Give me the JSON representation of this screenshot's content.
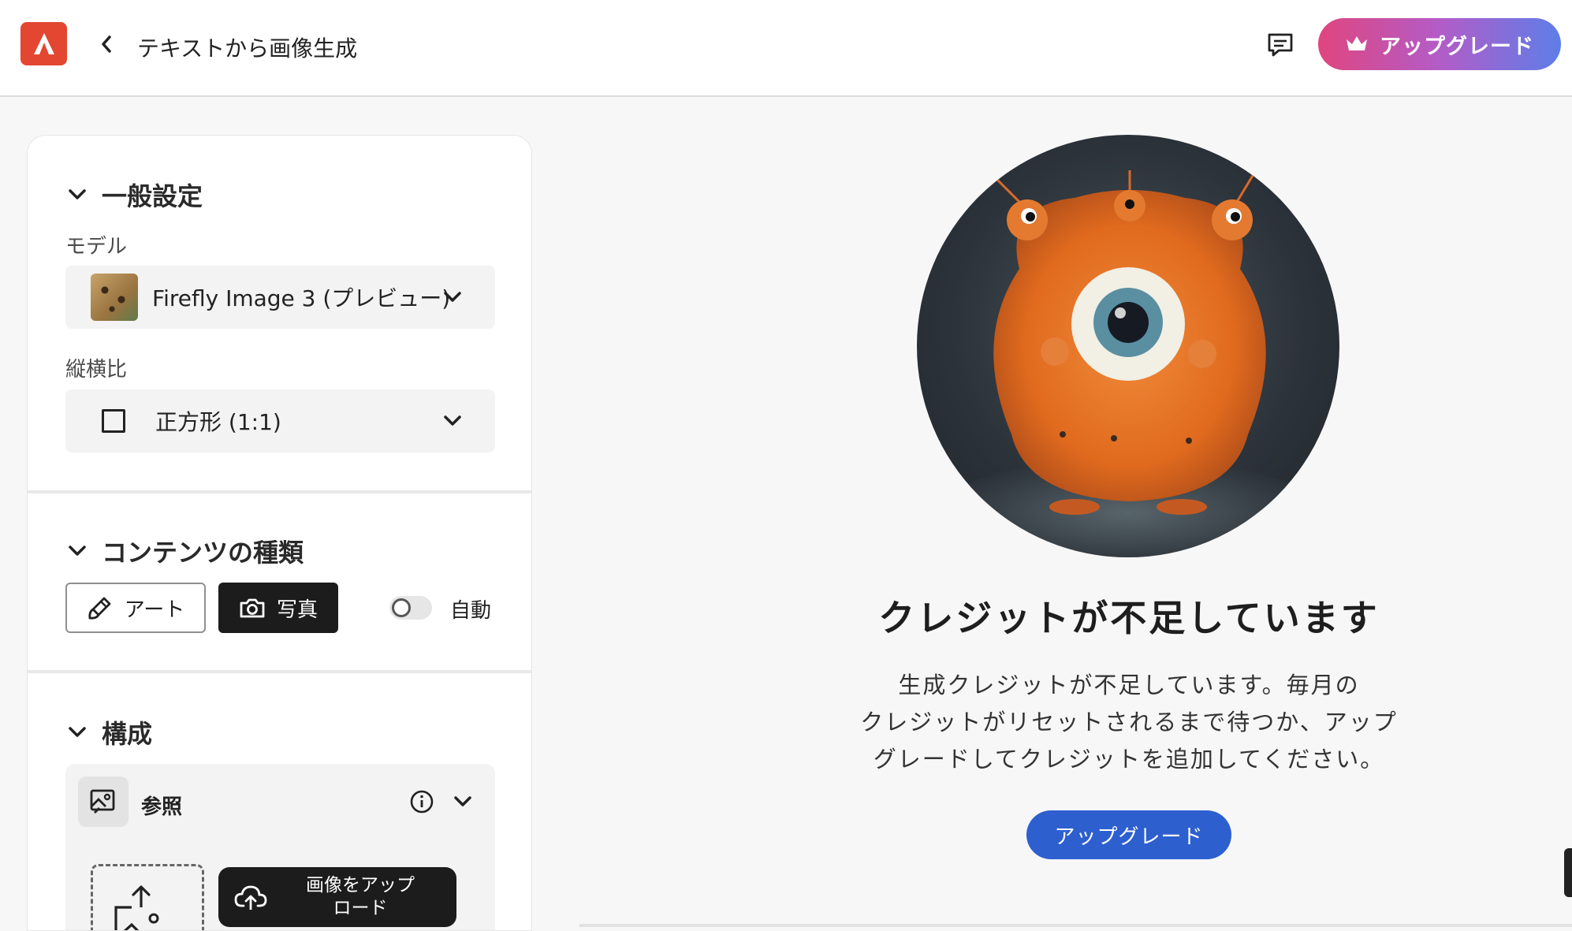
{
  "header": {
    "title": "テキストから画像生成",
    "upgrade_label": "アップグレード"
  },
  "panel": {
    "general": {
      "heading": "一般設定",
      "model_label": "モデル",
      "model_value": "Firefly Image 3 (プレビュー)",
      "aspect_label": "縦横比",
      "aspect_value": "正方形 (1:1)"
    },
    "content_type": {
      "heading": "コンテンツの種類",
      "art_label": "アート",
      "photo_label": "写真",
      "auto_label": "自動",
      "selected": "写真",
      "auto_enabled": false
    },
    "composition": {
      "heading": "構成",
      "reference_label": "参照",
      "upload_label_line1": "画像をアップ",
      "upload_label_line2": "ロード"
    }
  },
  "main": {
    "title": "クレジットが不足しています",
    "body_line1": "生成クレジットが不足しています。毎月の",
    "body_line2": "クレジットがリセットされるまで待つか、アップ",
    "body_line3": "グレードしてクレジットを追加してください。",
    "upgrade_label": "アップグレード"
  },
  "colors": {
    "logo": "#e34631",
    "upgrade_primary": "#2d5fcf",
    "upgrade_gradient_start": "#e0457e",
    "upgrade_gradient_end": "#5d7ee8"
  }
}
